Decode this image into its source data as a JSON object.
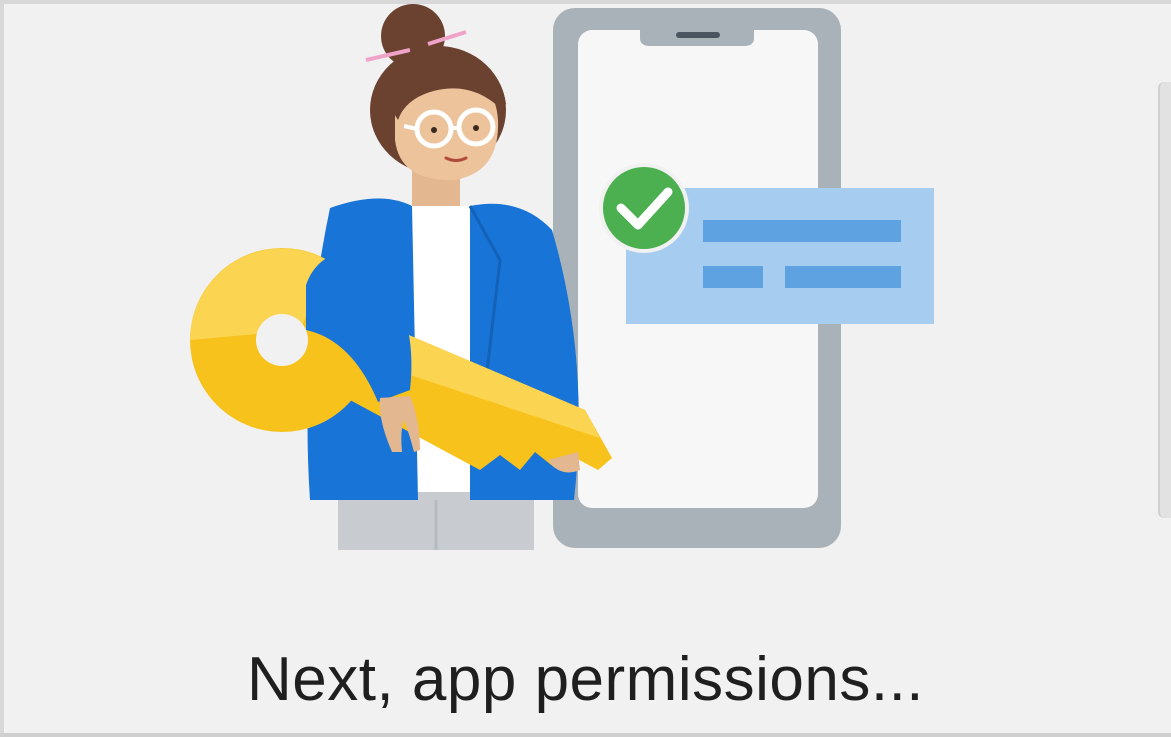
{
  "screen": {
    "headline": "Next, app permissions..."
  },
  "illustration": {
    "subject": "person-holding-key-beside-phone",
    "icons": [
      "key-icon",
      "check-circle-icon",
      "phone-icon"
    ]
  },
  "colors": {
    "background": "#f1f1f1",
    "phone_frame": "#a8b0b8",
    "card_blue": "#9cc7ee",
    "card_bar": "#5a9fe0",
    "check_green": "#4caf50",
    "key_yellow": "#f8c21c",
    "jacket_blue": "#1773d6"
  }
}
